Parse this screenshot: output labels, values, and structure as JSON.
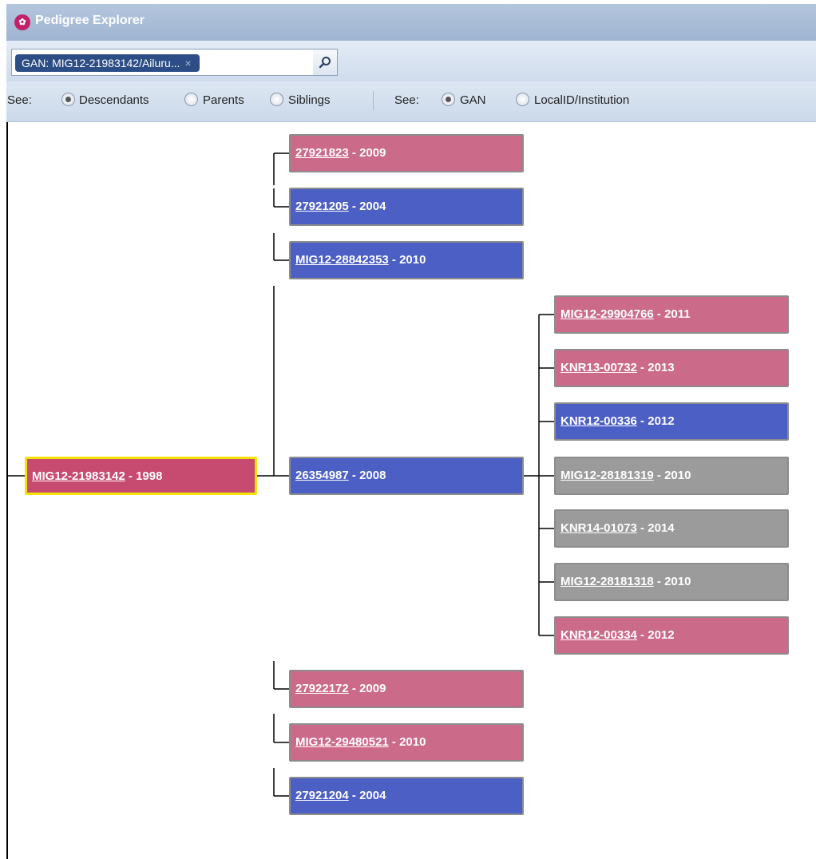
{
  "window": {
    "title": "Pedigree Explorer",
    "logo_icon": "logo-icon"
  },
  "search": {
    "chip_label": "GAN: MIG12-21983142/Ailuru...",
    "chip_close": "×",
    "button_icon": "search-icon"
  },
  "options": {
    "see_label_1": "See:",
    "group1": [
      {
        "label": "Descendants",
        "selected": true
      },
      {
        "label": "Parents",
        "selected": false
      },
      {
        "label": "Siblings",
        "selected": false
      }
    ],
    "see_label_2": "See:",
    "group2": [
      {
        "label": "GAN",
        "selected": true
      },
      {
        "label": "LocalID/Institution",
        "selected": false
      }
    ]
  },
  "colors": {
    "female": "#cc6a8a",
    "male": "#4b5fc4",
    "unknown": "#9b9b9b",
    "root": "#c74a71",
    "selected_border": "#f5e20a"
  },
  "tree": {
    "root": {
      "id": "MIG12-21983142",
      "year": "1998",
      "sex": "root",
      "selected": true
    },
    "children": [
      {
        "id": "27921823",
        "year": "2009",
        "sex": "female"
      },
      {
        "id": "27921205",
        "year": "2004",
        "sex": "male"
      },
      {
        "id": "MIG12-28842353",
        "year": "2010",
        "sex": "male"
      },
      {
        "id": "26354987",
        "year": "2008",
        "sex": "male",
        "children": [
          {
            "id": "MIG12-29904766",
            "year": "2011",
            "sex": "female"
          },
          {
            "id": "KNR13-00732",
            "year": "2013",
            "sex": "female"
          },
          {
            "id": "KNR12-00336",
            "year": "2012",
            "sex": "male"
          },
          {
            "id": "MIG12-28181319",
            "year": "2010",
            "sex": "unknown"
          },
          {
            "id": "KNR14-01073",
            "year": "2014",
            "sex": "unknown"
          },
          {
            "id": "MIG12-28181318",
            "year": "2010",
            "sex": "unknown"
          },
          {
            "id": "KNR12-00334",
            "year": "2012",
            "sex": "female"
          }
        ]
      },
      {
        "id": "27922172",
        "year": "2009",
        "sex": "female"
      },
      {
        "id": "MIG12-29480521",
        "year": "2010",
        "sex": "female"
      },
      {
        "id": "27921204",
        "year": "2004",
        "sex": "male"
      }
    ]
  }
}
